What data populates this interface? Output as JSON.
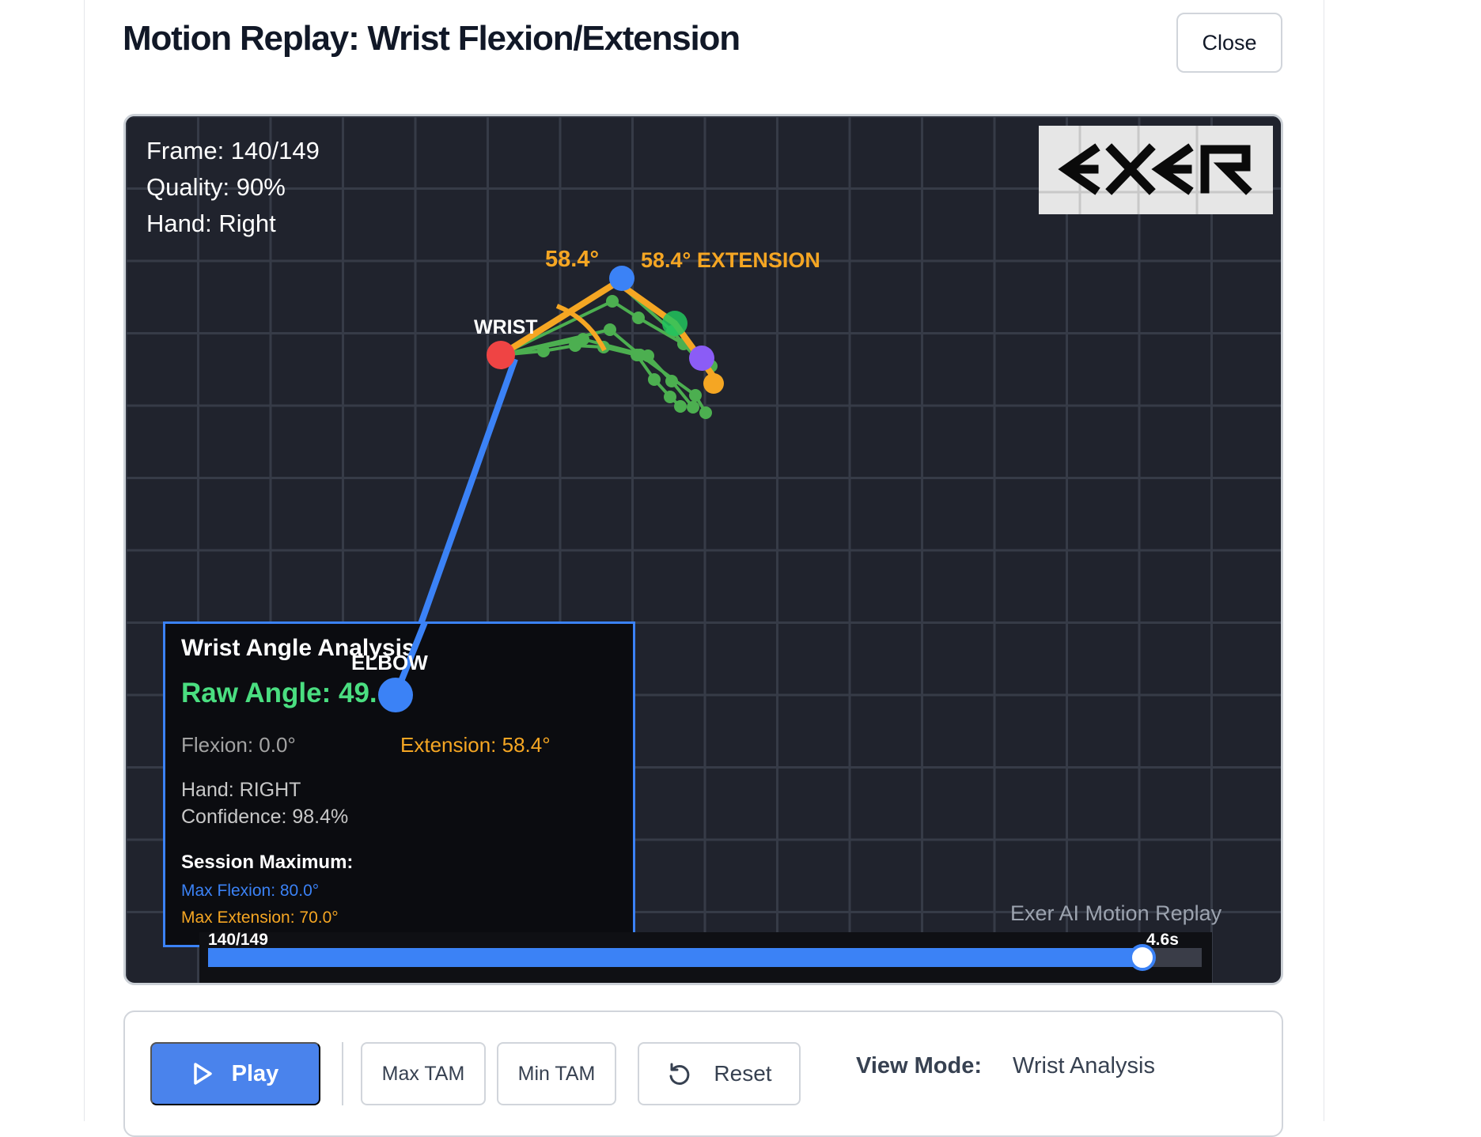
{
  "modal": {
    "title": "Motion Replay: Wrist Flexion/Extension",
    "close_label": "Close"
  },
  "overlay": {
    "frame": "Frame: 140/149",
    "quality": "Quality: 90%",
    "hand": "Hand: Right"
  },
  "logo": {
    "text": "EXER",
    "icon": "exer-logo"
  },
  "skeleton": {
    "angle_value": "58.4°",
    "angle_state": "58.4° EXTENSION",
    "wrist_label": "WRIST",
    "elbow_label": "ELBOW"
  },
  "analysis": {
    "title": "Wrist Angle Analysis",
    "raw_angle": "Raw Angle: 49.",
    "flexion": "Flexion: 0.0°",
    "extension": "Extension: 58.4°",
    "hand": "Hand: RIGHT",
    "confidence": "Confidence: 98.4%",
    "session_max_title": "Session Maximum:",
    "max_flexion": "Max Flexion: 80.0°",
    "max_extension": "Max Extension: 70.0°"
  },
  "watermark": "Exer AI Motion Replay",
  "timeline": {
    "frame_label": "140/149",
    "time_label": "4.6s",
    "progress": 0.94
  },
  "controls": {
    "play_label": "Play",
    "max_tam_label": "Max TAM",
    "min_tam_label": "Min TAM",
    "reset_label": "Reset",
    "view_mode_label": "View Mode:",
    "view_mode_value": "Wrist Analysis"
  },
  "colors": {
    "accent_blue": "#3b82f6",
    "extension_orange": "#f5a623",
    "finger_green": "#4caf50",
    "wrist_red": "#ef4444",
    "viewer_bg": "#20232d"
  }
}
